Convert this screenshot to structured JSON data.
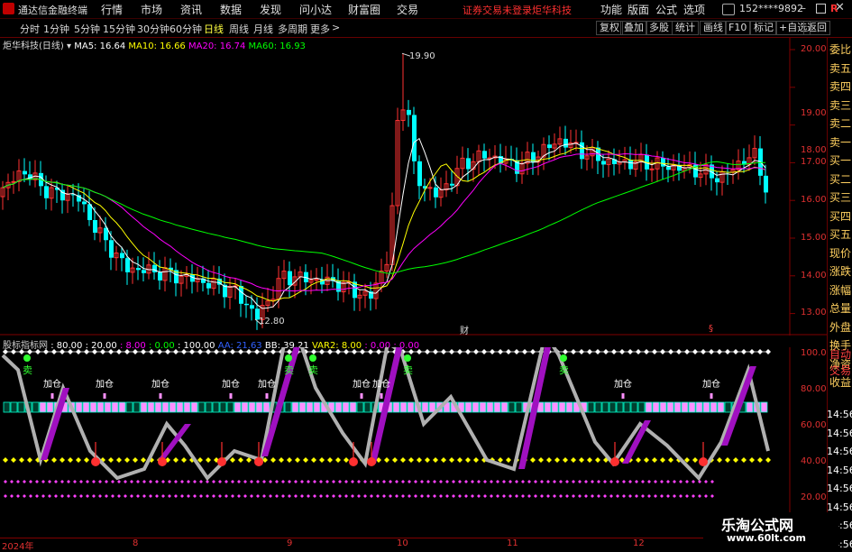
{
  "app": {
    "title": "通达信金融终端",
    "menus": [
      "行情",
      "市场",
      "资讯",
      "数据",
      "发现",
      "问小达",
      "财富圈",
      "交易"
    ],
    "warning": "证券交易未登录",
    "stock_title": "炬华科技",
    "right_menus": [
      "功能",
      "版面",
      "公式",
      "选项"
    ],
    "user": "152****9892",
    "r_badge": "R"
  },
  "periods": [
    "分时",
    "1分钟",
    "5分钟",
    "15分钟",
    "30分钟",
    "60分钟",
    "日线",
    "周线",
    "月线",
    "多周期",
    "更多"
  ],
  "active_period": "日线",
  "tools": [
    "复权",
    "叠加",
    "多股",
    "统计",
    "画线",
    "F10",
    "标记",
    "+自选",
    "返回"
  ],
  "main_legend": {
    "name": "炬华科技(日线)",
    "ma5": "MA5: 16.64",
    "ma10": "MA10: 16.66",
    "ma20": "MA20: 16.74",
    "ma60": "MA60: 16.93"
  },
  "price_axis": [
    "20.00",
    "19.00",
    "18.00",
    "17.00",
    "16.00",
    "15.00",
    "14.00",
    "13.00"
  ],
  "annotations": {
    "high": "19.90",
    "low": "12.80",
    "cai": "财",
    "s_mark": "§"
  },
  "right_panel": [
    "委比",
    "卖五",
    "卖四",
    "卖三",
    "卖二",
    "卖一",
    "买一",
    "买二",
    "买三",
    "买四",
    "买五",
    "现价",
    "涨跌",
    "涨幅",
    "总量",
    "外盘",
    "换手",
    "净资",
    "收益"
  ],
  "indicator_legend": {
    "name": "股标指标网",
    "v1": ": 80.00",
    "v2": ": 20.00",
    "v3": ": 8.00",
    "v4": ": 0.00",
    "v5": ": 100.00",
    "aa": "AA: 21.63",
    "bb": "BB: 39.21",
    "var2": "VAR2: 8.00",
    "v6": ": 0.00",
    "v7": ": 0.00"
  },
  "indicator_axis": [
    "100.00",
    "80.00",
    "60.00",
    "40.00",
    "20.00"
  ],
  "right_bottom_panel": [
    "自动",
    "交易"
  ],
  "time_labels": [
    "14:56",
    "14:56",
    "14:56",
    "14:56",
    "14:56",
    "14:56",
    "14:56",
    "14:56"
  ],
  "signals": {
    "sell": "卖",
    "add": "加仓"
  },
  "date_axis": [
    "2024年",
    "8",
    "9",
    "10",
    "11",
    "12"
  ],
  "watermark": {
    "line1": "乐淘公式网",
    "line2": "www.60lt.com"
  },
  "colors": {
    "up": "#ff3232",
    "down": "#00ffff",
    "ma5": "#ffffff",
    "ma10": "#ffff00",
    "ma20": "#ff00ff",
    "ma60": "#00ff00",
    "axis": "#e03030"
  }
}
